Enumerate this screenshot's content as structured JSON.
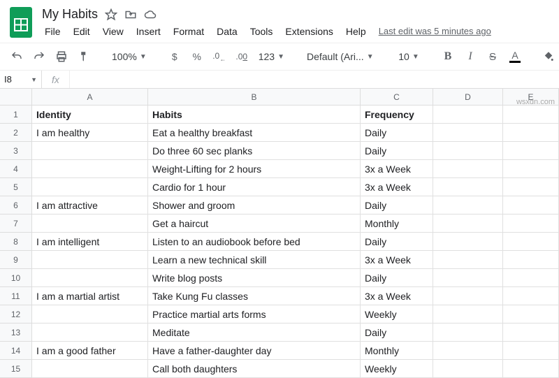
{
  "doc": {
    "title": "My Habits",
    "last_edit": "Last edit was 5 minutes ago"
  },
  "menus": [
    "File",
    "Edit",
    "View",
    "Insert",
    "Format",
    "Data",
    "Tools",
    "Extensions",
    "Help"
  ],
  "toolbar": {
    "zoom": "100%",
    "currency": "$",
    "percent": "%",
    "dec_less": ".0",
    "dec_more": ".00",
    "num_format": "123",
    "font": "Default (Ari...",
    "font_size": "10",
    "bold": "B",
    "italic": "I",
    "strike": "S",
    "text_color": "A"
  },
  "namebox": {
    "ref": "I8",
    "fx": "fx"
  },
  "columns": [
    "A",
    "B",
    "C",
    "D",
    "E"
  ],
  "rows": [
    {
      "n": 1,
      "A": "Identity",
      "B": "Habits",
      "C": "Frequency",
      "D": "",
      "E": "",
      "bold": true
    },
    {
      "n": 2,
      "A": "I am healthy",
      "B": "Eat a healthy breakfast",
      "C": "Daily",
      "D": "",
      "E": ""
    },
    {
      "n": 3,
      "A": "",
      "B": "Do three 60 sec planks",
      "C": "Daily",
      "D": "",
      "E": ""
    },
    {
      "n": 4,
      "A": "",
      "B": "Weight-Lifting for 2 hours",
      "C": "3x a Week",
      "D": "",
      "E": ""
    },
    {
      "n": 5,
      "A": "",
      "B": "Cardio for 1 hour",
      "C": "3x a Week",
      "D": "",
      "E": ""
    },
    {
      "n": 6,
      "A": "I am attractive",
      "B": "Shower and groom",
      "C": "Daily",
      "D": "",
      "E": ""
    },
    {
      "n": 7,
      "A": "",
      "B": "Get a haircut",
      "C": "Monthly",
      "D": "",
      "E": ""
    },
    {
      "n": 8,
      "A": "I am intelligent",
      "B": "Listen to an audiobook before bed",
      "C": "Daily",
      "D": "",
      "E": ""
    },
    {
      "n": 9,
      "A": "",
      "B": "Learn a new technical skill",
      "C": "3x a Week",
      "D": "",
      "E": ""
    },
    {
      "n": 10,
      "A": "",
      "B": "Write blog posts",
      "C": "Daily",
      "D": "",
      "E": ""
    },
    {
      "n": 11,
      "A": "I am a martial artist",
      "B": "Take Kung Fu classes",
      "C": "3x a Week",
      "D": "",
      "E": ""
    },
    {
      "n": 12,
      "A": "",
      "B": "Practice martial arts forms",
      "C": "Weekly",
      "D": "",
      "E": ""
    },
    {
      "n": 13,
      "A": "",
      "B": "Meditate",
      "C": "Daily",
      "D": "",
      "E": ""
    },
    {
      "n": 14,
      "A": "I am a good father",
      "B": "Have a father-daughter day",
      "C": "Monthly",
      "D": "",
      "E": ""
    },
    {
      "n": 15,
      "A": "",
      "B": "Call both daughters",
      "C": "Weekly",
      "D": "",
      "E": ""
    }
  ],
  "watermark": "wsxdn.com"
}
